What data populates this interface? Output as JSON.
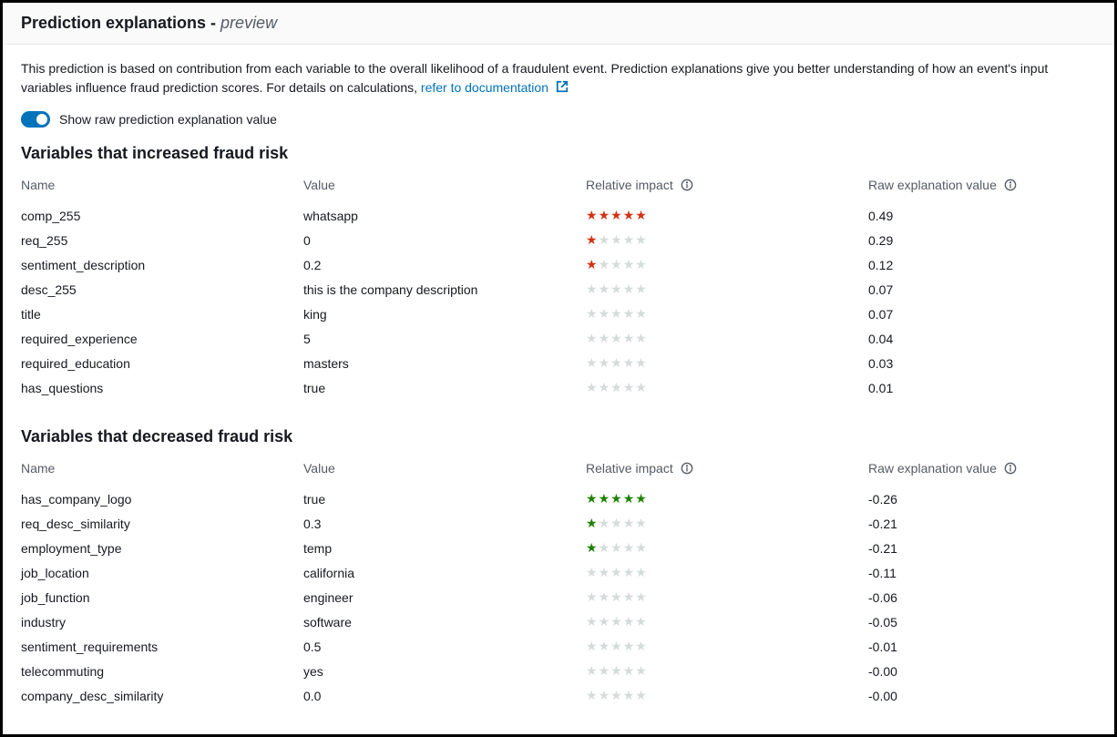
{
  "header": {
    "title": "Prediction explanations - ",
    "preview": "preview"
  },
  "intro": {
    "text": "This prediction is based on contribution from each variable to the overall likelihood of a fraudulent event. Prediction explanations give you better understanding of how an event's input variables influence fraud prediction scores. For details on calculations, ",
    "link_text": "refer to documentation"
  },
  "toggle": {
    "label": "Show raw prediction explanation value",
    "on": true
  },
  "columns": {
    "name": "Name",
    "value": "Value",
    "impact": "Relative impact",
    "raw": "Raw explanation value"
  },
  "increased": {
    "heading": "Variables that increased fraud risk",
    "rows": [
      {
        "name": "comp_255",
        "value": "whatsapp",
        "stars": 5,
        "raw": "0.49"
      },
      {
        "name": "req_255",
        "value": "0",
        "stars": 1,
        "raw": "0.29"
      },
      {
        "name": "sentiment_description",
        "value": "0.2",
        "stars": 1,
        "raw": "0.12"
      },
      {
        "name": "desc_255",
        "value": "this is the company description",
        "stars": 0,
        "raw": "0.07"
      },
      {
        "name": "title",
        "value": "king",
        "stars": 0,
        "raw": "0.07"
      },
      {
        "name": "required_experience",
        "value": "5",
        "stars": 0,
        "raw": "0.04"
      },
      {
        "name": "required_education",
        "value": "masters",
        "stars": 0,
        "raw": "0.03"
      },
      {
        "name": "has_questions",
        "value": "true",
        "stars": 0,
        "raw": "0.01"
      }
    ]
  },
  "decreased": {
    "heading": "Variables that decreased fraud risk",
    "rows": [
      {
        "name": "has_company_logo",
        "value": "true",
        "stars": 5,
        "raw": "-0.26"
      },
      {
        "name": "req_desc_similarity",
        "value": "0.3",
        "stars": 1,
        "raw": "-0.21"
      },
      {
        "name": "employment_type",
        "value": "temp",
        "stars": 1,
        "raw": "-0.21"
      },
      {
        "name": "job_location",
        "value": "california",
        "stars": 0,
        "raw": "-0.11"
      },
      {
        "name": "job_function",
        "value": "engineer",
        "stars": 0,
        "raw": "-0.06"
      },
      {
        "name": "industry",
        "value": "software",
        "stars": 0,
        "raw": "-0.05"
      },
      {
        "name": "sentiment_requirements",
        "value": "0.5",
        "stars": 0,
        "raw": "-0.01"
      },
      {
        "name": "telecommuting",
        "value": "yes",
        "stars": 0,
        "raw": "-0.00"
      },
      {
        "name": "company_desc_similarity",
        "value": "0.0",
        "stars": 0,
        "raw": "-0.00"
      }
    ]
  }
}
